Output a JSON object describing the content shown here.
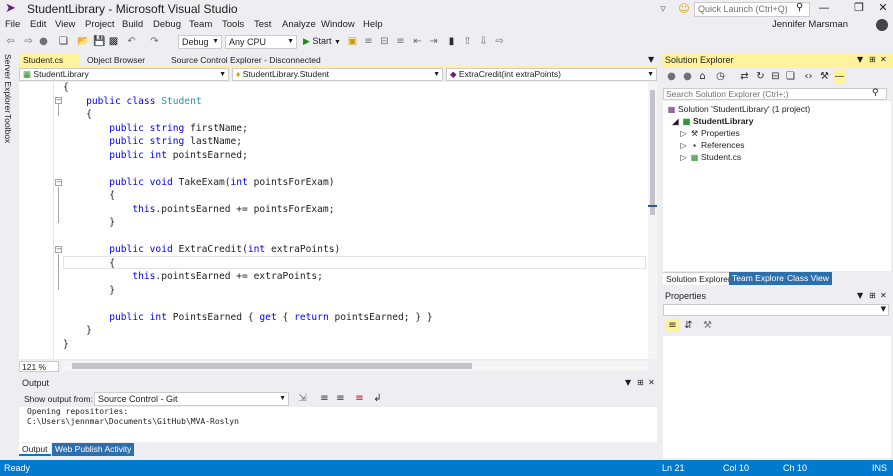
{
  "window": {
    "title": "StudentLibrary - Microsoft Visual Studio",
    "quick_launch_placeholder": "Quick Launch (Ctrl+Q)",
    "user": "Jennifer Marsman"
  },
  "menu": [
    "File",
    "Edit",
    "View",
    "Project",
    "Build",
    "Debug",
    "Team",
    "Tools",
    "Test",
    "Analyze",
    "Window",
    "Help"
  ],
  "toolbar": {
    "configuration": "Debug",
    "platform": "Any CPU",
    "start_label": "Start"
  },
  "side_strip": [
    "Server Explorer",
    "Toolbox"
  ],
  "doc_tabs": [
    {
      "label": "Student.cs",
      "active": true
    },
    {
      "label": "Object Browser",
      "active": false
    },
    {
      "label": "Source Control Explorer - Disconnected",
      "active": false
    }
  ],
  "nav_bar": {
    "project": "StudentLibrary",
    "type": "StudentLibrary.Student",
    "member": "ExtraCredit(int extraPoints)"
  },
  "code": {
    "lines": [
      "{",
      "    public class Student",
      "    {",
      "        public string firstName;",
      "        public string lastName;",
      "        public int pointsEarned;",
      "",
      "        public void TakeExam(int pointsForExam)",
      "        {",
      "            this.pointsEarned += pointsForExam;",
      "        }",
      "",
      "        public void ExtraCredit(int extraPoints)",
      "        {",
      "            this.pointsEarned += extraPoints;",
      "        }",
      "",
      "        public int PointsEarned { get { return pointsEarned; } }",
      "    }",
      "}"
    ]
  },
  "zoom": "121 %",
  "output": {
    "title": "Output",
    "show_from_label": "Show output from:",
    "source": "Source Control - Git",
    "lines": [
      "Opening repositories:",
      "C:\\Users\\jennmar\\Documents\\GitHub\\MVA-Roslyn"
    ],
    "tabs": [
      "Output",
      "Web Publish Activity"
    ]
  },
  "solution_explorer": {
    "title": "Solution Explorer",
    "search_placeholder": "Search Solution Explorer (Ctrl+;)",
    "tree": [
      {
        "label": "Solution 'StudentLibrary' (1 project)",
        "level": 0
      },
      {
        "label": "StudentLibrary",
        "level": 1
      },
      {
        "label": "Properties",
        "level": 2
      },
      {
        "label": "References",
        "level": 2
      },
      {
        "label": "Student.cs",
        "level": 2
      }
    ],
    "tabs": [
      "Solution Explorer",
      "Team Explorer",
      "Class View"
    ]
  },
  "properties": {
    "title": "Properties"
  },
  "status": {
    "state": "Ready",
    "line": "Ln 21",
    "col": "Col 10",
    "ch": "Ch 10",
    "mode": "INS"
  },
  "colors": {
    "accent": "#007acc",
    "active_tab": "#fff29d",
    "keyword": "#0000ff",
    "type": "#2b91af",
    "brand": "#68217a"
  }
}
